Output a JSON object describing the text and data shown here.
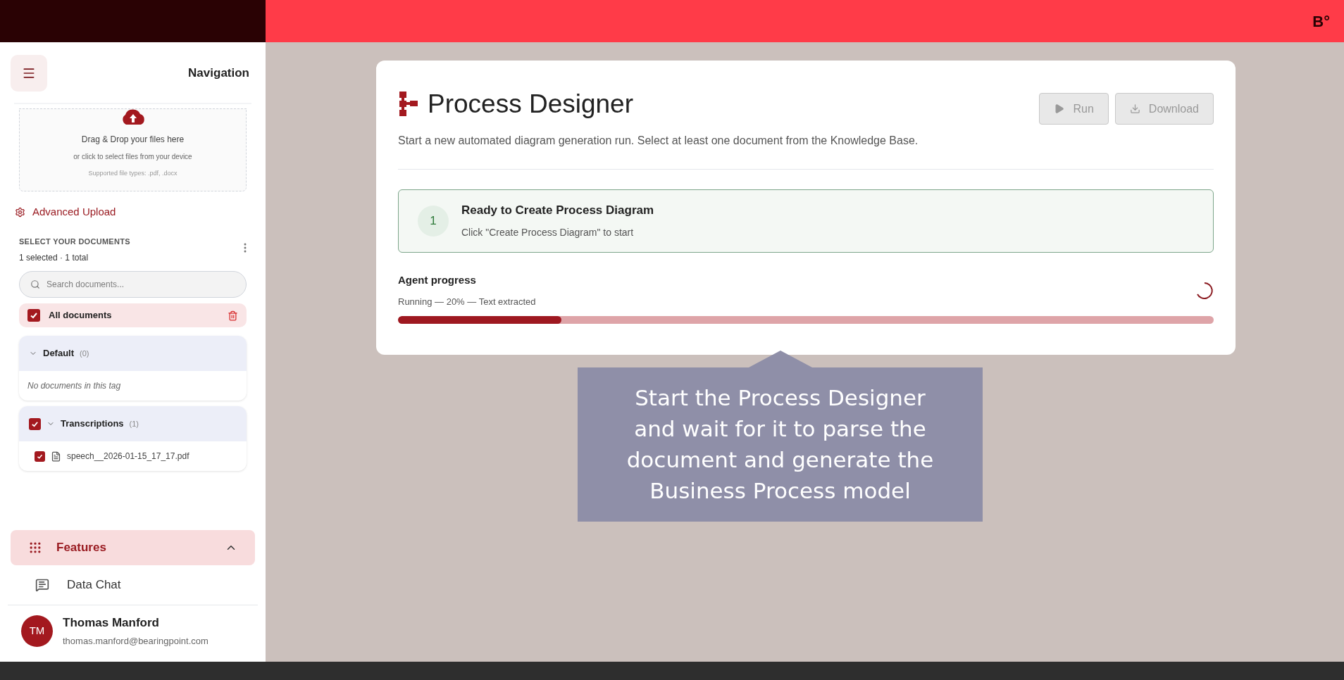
{
  "topbar": {
    "logo": "B°"
  },
  "sidebar": {
    "title": "Navigation",
    "upload": {
      "title": "Drag & Drop your files here",
      "subtitle": "or click to select files from your device",
      "hint": "Supported file types: .pdf, .docx"
    },
    "advanced_upload": "Advanced Upload",
    "documents": {
      "heading": "SELECT YOUR DOCUMENTS",
      "summary": "1 selected · 1 total",
      "search": {
        "placeholder": "Search documents..."
      },
      "all": {
        "label": "All documents",
        "checked": true
      },
      "groups": [
        {
          "name": "Default",
          "count": "(0)",
          "expanded": true,
          "empty_text": "No documents in this tag"
        },
        {
          "name": "Transcriptions",
          "count": "(1)",
          "expanded": true,
          "checked": true,
          "children": [
            {
              "name": "speech__2026-01-15_17_17.pdf",
              "checked": true
            }
          ]
        }
      ]
    },
    "features": {
      "label": "Features",
      "expanded": true,
      "items": [
        {
          "label": "Data Chat"
        }
      ]
    },
    "user": {
      "initials": "TM",
      "name": "Thomas Manford",
      "email": "thomas.manford@bearingpoint.com"
    }
  },
  "main": {
    "title": "Process Designer",
    "subtitle": "Start a new automated diagram generation run. Select at least one document from the Knowledge Base.",
    "buttons": [
      {
        "kind": "run",
        "label": "Run",
        "disabled": true
      },
      {
        "kind": "download",
        "label": "Download",
        "disabled": true
      }
    ],
    "step": {
      "number": "1",
      "title": "Ready to Create Process Diagram",
      "text": "Click \"Create Process Diagram\" to start"
    },
    "progress": {
      "title": "Agent progress",
      "status": "Running — 20% — Text extracted",
      "level": 0.2,
      "running": true
    }
  },
  "callout": {
    "text": "Start the Process Designer and wait for it to parse the document and generate the Business Process model"
  }
}
